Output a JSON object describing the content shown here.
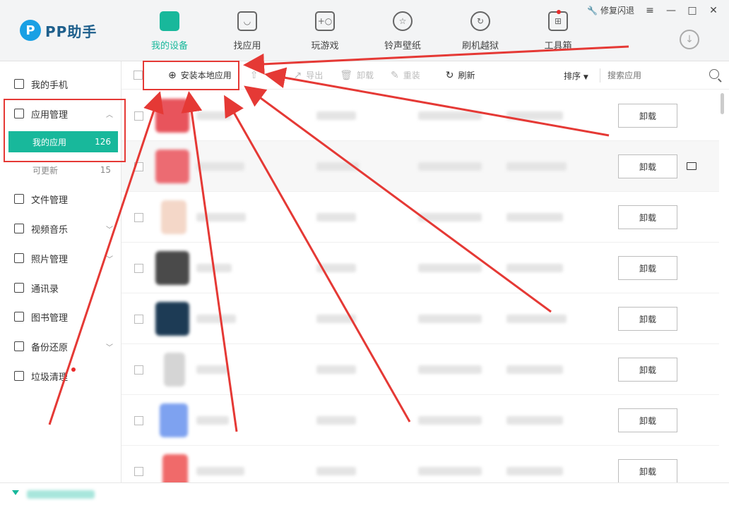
{
  "header": {
    "logo_text": "PP助手",
    "logo_mark": "P",
    "tabs": [
      {
        "label": "我的设备",
        "icon": "phone-icon",
        "active": true
      },
      {
        "label": "找应用",
        "icon": "bag-icon",
        "active": false
      },
      {
        "label": "玩游戏",
        "icon": "gamepad-icon",
        "active": false
      },
      {
        "label": "铃声壁纸",
        "icon": "star-icon",
        "active": false
      },
      {
        "label": "刷机越狱",
        "icon": "refresh-icon",
        "active": false
      },
      {
        "label": "工具箱",
        "icon": "toolbox-icon",
        "active": false
      }
    ],
    "repair_label": "修复闪退",
    "accent_color": "#18b89b"
  },
  "sidebar": {
    "items": [
      {
        "label": "我的手机",
        "icon": "phone-icon"
      },
      {
        "label": "应用管理",
        "icon": "app-icon"
      },
      {
        "label": "文件管理",
        "icon": "file-icon"
      },
      {
        "label": "视频音乐",
        "icon": "play-icon"
      },
      {
        "label": "照片管理",
        "icon": "photo-icon"
      },
      {
        "label": "通讯录",
        "icon": "contacts-icon"
      },
      {
        "label": "图书管理",
        "icon": "book-icon"
      },
      {
        "label": "备份还原",
        "icon": "backup-icon"
      },
      {
        "label": "垃圾清理",
        "icon": "trash-icon"
      }
    ],
    "subitems": [
      {
        "label": "我的应用",
        "count": "126"
      },
      {
        "label": "可更新",
        "count": "15"
      }
    ]
  },
  "toolbar": {
    "install_local": "安装本地应用",
    "export": "导出",
    "uninstall": "卸载",
    "reinstall": "重装",
    "refresh": "刷新",
    "sort": "排序",
    "search_placeholder": "搜索应用"
  },
  "list": {
    "uninstall_label": "卸载",
    "rows": [
      {
        "icon_color": "#e8545c"
      },
      {
        "icon_color": "#ec6b72"
      },
      {
        "icon_color": "#f4d7c8"
      },
      {
        "icon_color": "#4a4a4a"
      },
      {
        "icon_color": "#1d3b55"
      },
      {
        "icon_color": "#d5d5d5"
      },
      {
        "icon_color": "#7ea2f0"
      },
      {
        "icon_color": "#f06a6a"
      }
    ]
  }
}
